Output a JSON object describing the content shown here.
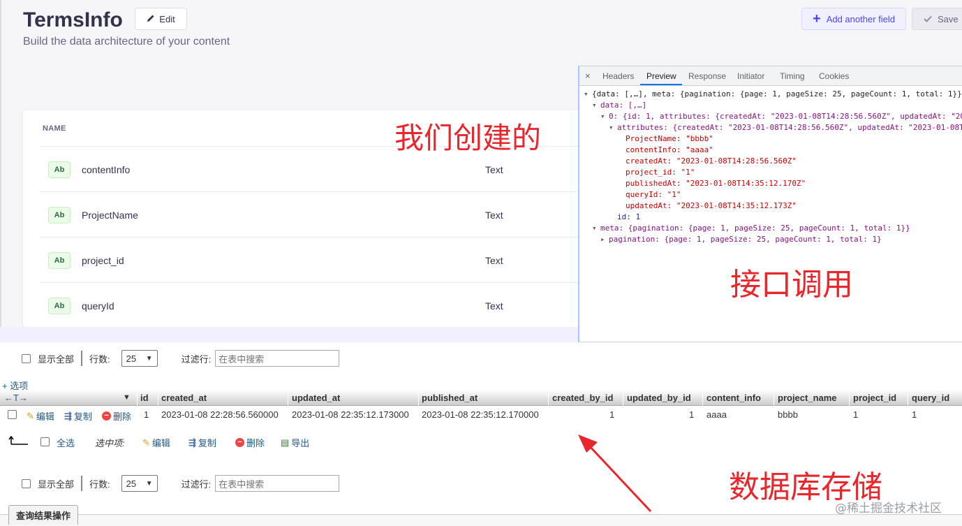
{
  "cms": {
    "title": "TermsInfo",
    "edit_label": "Edit",
    "subtitle": "Build the data architecture of your content",
    "add_field_label": "Add another field",
    "save_label": "Save",
    "name_header": "NAME",
    "fields": [
      {
        "badge": "Ab",
        "name": "contentInfo",
        "type": "Text"
      },
      {
        "badge": "Ab",
        "name": "ProjectName",
        "type": "Text"
      },
      {
        "badge": "Ab",
        "name": "project_id",
        "type": "Text"
      },
      {
        "badge": "Ab",
        "name": "queryId",
        "type": "Text"
      }
    ]
  },
  "annotations": {
    "created_by_us": "我们创建的",
    "api_call": "接口调用",
    "db_storage": "数据库存储",
    "arrow_color": "#e8262b"
  },
  "devtools": {
    "tabs": [
      "Headers",
      "Preview",
      "Response",
      "Initiator",
      "Timing",
      "Cookies"
    ],
    "active_tab": "Preview",
    "close_glyph": "×",
    "lines": {
      "root": "{data: [,…], meta: {pagination: {page: 1, pageSize: 25, pageCount: 1, total: 1}}",
      "data": "data: [,…]",
      "item0": "0: {id: 1, attributes: {createdAt: \"2023-01-08T14:28:56.560Z\", updatedAt: \"20",
      "attributes": "attributes: {createdAt: \"2023-01-08T14:28:56.560Z\", updatedAt: \"2023-01-08T",
      "ProjectName": "ProjectName: \"bbbb\"",
      "contentInfo": "contentInfo: \"aaaa\"",
      "createdAt": "createdAt: \"2023-01-08T14:28:56.560Z\"",
      "project_id": "project_id: \"1\"",
      "publishedAt": "publishedAt: \"2023-01-08T14:35:12.170Z\"",
      "queryId": "queryId: \"1\"",
      "updatedAt": "updatedAt: \"2023-01-08T14:35:12.173Z\"",
      "id": "id: 1",
      "meta": "meta: {pagination: {page: 1, pageSize: 25, pageCount: 1, total: 1}}",
      "pagination": "pagination: {page: 1, pageSize: 25, pageCount: 1, total: 1}"
    }
  },
  "pma": {
    "show_all": "显示全部",
    "rows_label": "行数:",
    "rows_value": "25",
    "filter_label": "过滤行:",
    "filter_placeholder": "在表中搜索",
    "options_link": "+ 选项",
    "nav_arrows": "←T→",
    "columns": [
      "id",
      "created_at",
      "updated_at",
      "published_at",
      "created_by_id",
      "updated_by_id",
      "content_info",
      "project_name",
      "project_id",
      "query_id"
    ],
    "row": {
      "id": "1",
      "created_at": "2023-01-08 22:28:56.560000",
      "updated_at": "2023-01-08 22:35:12.173000",
      "published_at": "2023-01-08 22:35:12.170000",
      "created_by_id": "1",
      "updated_by_id": "1",
      "content_info": "aaaa",
      "project_name": "bbbb",
      "project_id": "1",
      "query_id": "1"
    },
    "edit": "编辑",
    "copy": "复制",
    "delete": "删除",
    "select_all": "全选",
    "selected_label": "选中项:",
    "export": "导出",
    "query_ops": "查询结果操作",
    "watermark": "@稀土掘金技术社区"
  }
}
